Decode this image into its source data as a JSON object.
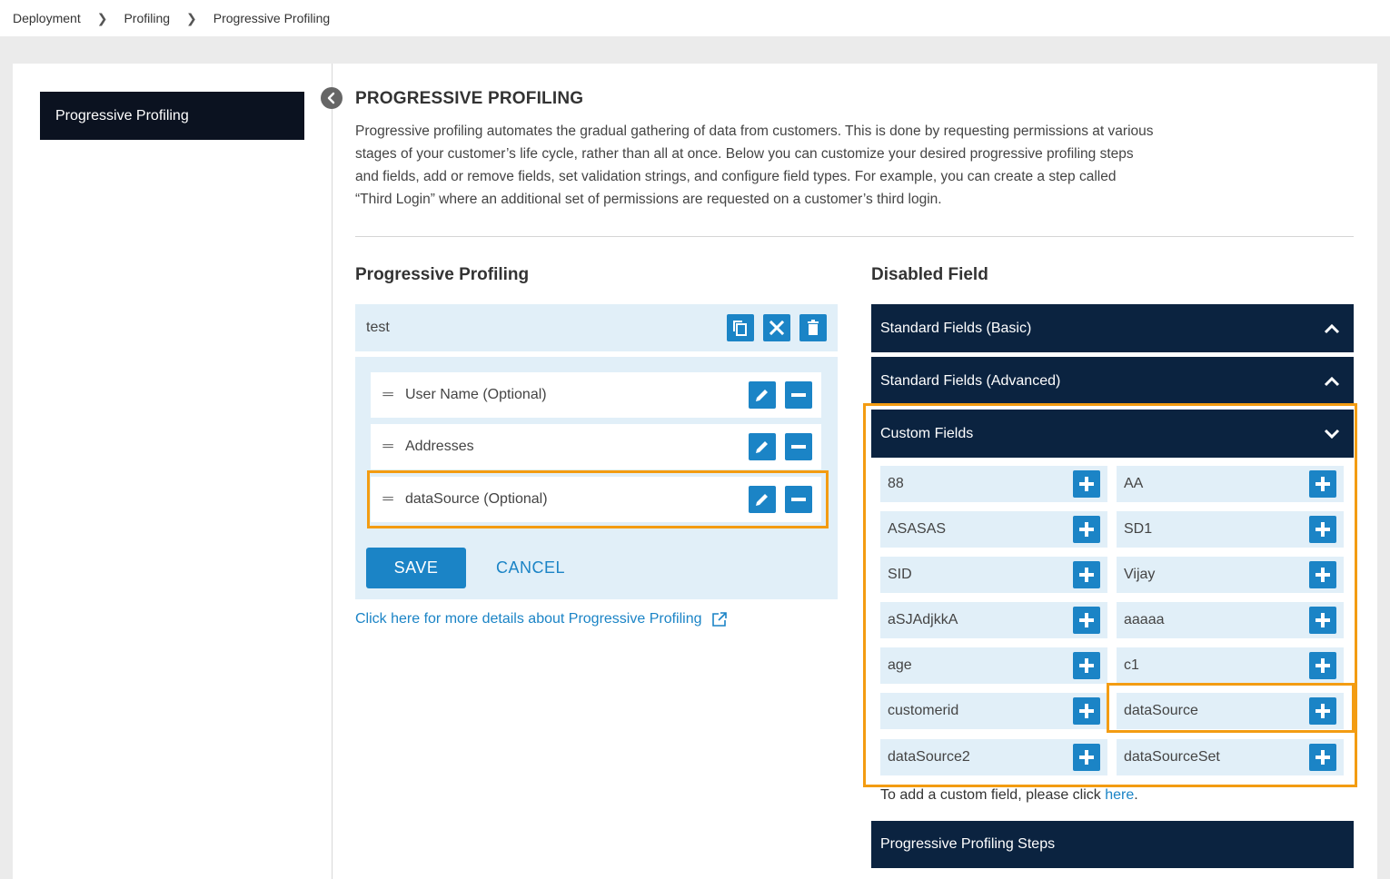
{
  "breadcrumb": [
    "Deployment",
    "Profiling",
    "Progressive Profiling"
  ],
  "sidebar": {
    "items": [
      {
        "label": "Progressive Profiling"
      }
    ]
  },
  "main": {
    "title": "PROGRESSIVE PROFILING",
    "description": "Progressive profiling automates the gradual gathering of data from customers. This is done by requesting permissions at various stages of your customer’s life cycle, rather than all at once. Below you can customize your desired progressive profiling steps and fields, add or remove fields, set validation strings, and configure field types. For example, you can create a step called “Third Login” where an additional set of permissions are requested on a customer’s third login."
  },
  "profiling": {
    "heading": "Progressive Profiling",
    "step_name": "test",
    "fields": [
      {
        "label": "User Name (Optional)"
      },
      {
        "label": "Addresses"
      },
      {
        "label": "dataSource (Optional)"
      }
    ],
    "save_label": "SAVE",
    "cancel_label": "CANCEL",
    "more_link": "Click here for more details about Progressive Profiling"
  },
  "disabled": {
    "heading": "Disabled Field",
    "sections": [
      {
        "label": "Standard Fields (Basic)",
        "state": "collapsed"
      },
      {
        "label": "Standard Fields (Advanced)",
        "state": "collapsed"
      },
      {
        "label": "Custom Fields",
        "state": "expanded"
      }
    ],
    "custom_fields": [
      "88",
      "AA",
      "ASASAS",
      "SD1",
      "SID",
      "Vijay",
      "aSJAdjkkA",
      "aaaaa",
      "age",
      "c1",
      "customerid",
      "dataSource",
      "dataSource2",
      "dataSourceSet"
    ],
    "add_note_prefix": "To add a custom field, please click ",
    "add_note_link": "here",
    "add_note_suffix": ".",
    "steps_section": "Progressive Profiling Steps"
  },
  "colors": {
    "accent": "#1b84c6",
    "dark_navy": "#0b2340",
    "sidebar_active": "#0b1220",
    "light_blue": "#e1eff8",
    "highlight": "#f39c12"
  }
}
